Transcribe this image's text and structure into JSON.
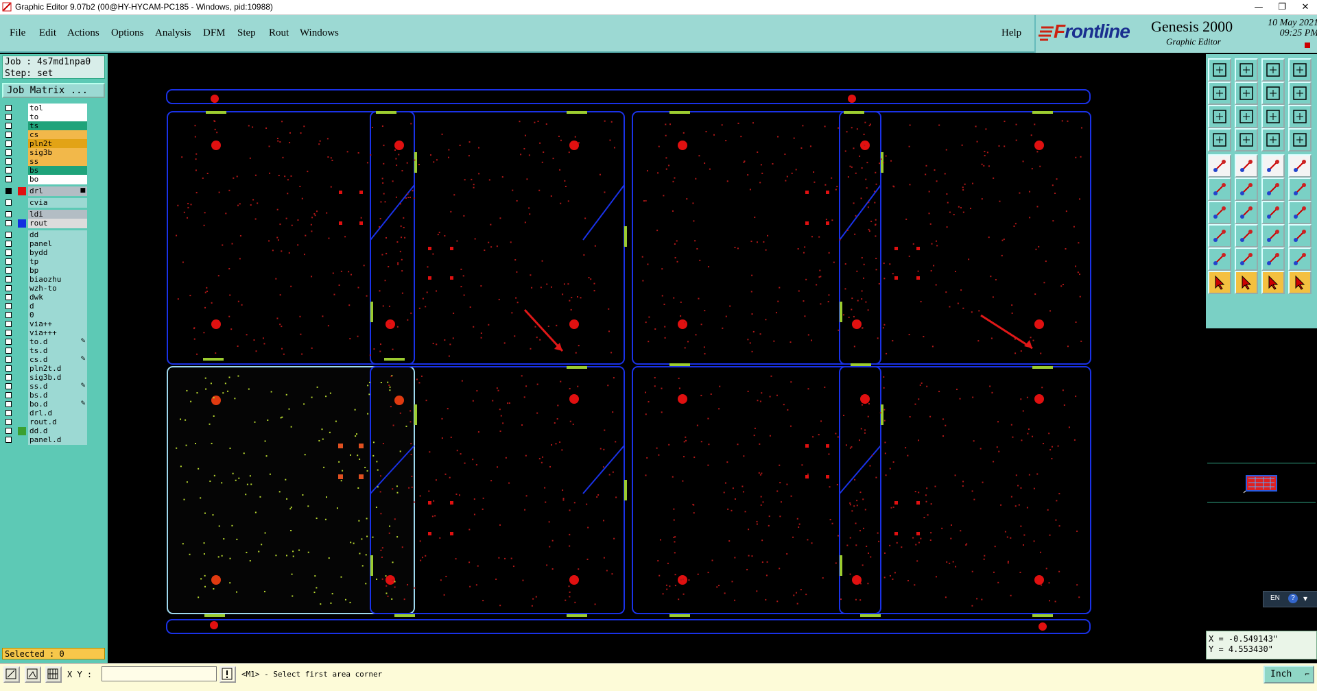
{
  "window": {
    "title": "Graphic Editor 9.07b2 (00@HY-HYCAM-PC185 - Windows, pid:10988)",
    "min": "—",
    "max": "❐",
    "close": "✕"
  },
  "menu": {
    "items": [
      {
        "id": "file",
        "label": "File"
      },
      {
        "id": "edit",
        "label": "Edit"
      },
      {
        "id": "actions",
        "label": "Actions"
      },
      {
        "id": "options",
        "label": "Options"
      },
      {
        "id": "analysis",
        "label": "Analysis"
      },
      {
        "id": "dfm",
        "label": "DFM"
      },
      {
        "id": "step",
        "label": "Step"
      },
      {
        "id": "rout",
        "label": "Rout"
      },
      {
        "id": "windows",
        "label": "Windows"
      }
    ],
    "help": "Help"
  },
  "brand": {
    "logo_first": "F",
    "logo_rest": "rontline",
    "product": "Genesis 2000",
    "subtitle": "Graphic Editor",
    "date": "10 May 2021",
    "time": "09:25 PM"
  },
  "job": {
    "job_line": "Job : 4s7md1npa0",
    "step_line": "Step: set",
    "matrix_button": "Job Matrix ..."
  },
  "layers": [
    {
      "name": "tol",
      "bg": "#ffffff",
      "swatch": ""
    },
    {
      "name": "to",
      "bg": "#ffffff",
      "swatch": ""
    },
    {
      "name": "ts",
      "bg": "#1fa37a",
      "swatch": ""
    },
    {
      "name": "cs",
      "bg": "#f2b84a",
      "swatch": ""
    },
    {
      "name": "pln2t",
      "bg": "#e2a316",
      "swatch": ""
    },
    {
      "name": "sig3b",
      "bg": "#f2b84a",
      "swatch": ""
    },
    {
      "name": "ss",
      "bg": "#f2b84a",
      "swatch": ""
    },
    {
      "name": "bs",
      "bg": "#1fa37a",
      "swatch": ""
    },
    {
      "name": "bo",
      "bg": "#ffffff",
      "swatch": ""
    },
    {
      "name": "drl",
      "bg": "#b3bdc4",
      "swatch": "#e01010",
      "mark": "■"
    },
    {
      "name": "cvia",
      "bg": "#9cd9d3",
      "swatch": ""
    },
    {
      "name": "ldi",
      "bg": "#b3bdc4",
      "swatch": ""
    },
    {
      "name": "rout",
      "bg": "#dcdcdc",
      "swatch": "#1030e0"
    },
    {
      "name": "dd",
      "bg": "#9cd9d3",
      "swatch": ""
    },
    {
      "name": "panel",
      "bg": "#9cd9d3",
      "swatch": ""
    },
    {
      "name": "bydd",
      "bg": "#9cd9d3",
      "swatch": ""
    },
    {
      "name": "tp",
      "bg": "#9cd9d3",
      "swatch": ""
    },
    {
      "name": "bp",
      "bg": "#9cd9d3",
      "swatch": ""
    },
    {
      "name": "biaozhu",
      "bg": "#9cd9d3",
      "swatch": ""
    },
    {
      "name": "wzh-to",
      "bg": "#9cd9d3",
      "swatch": ""
    },
    {
      "name": "dwk",
      "bg": "#9cd9d3",
      "swatch": ""
    },
    {
      "name": "d",
      "bg": "#9cd9d3",
      "swatch": ""
    },
    {
      "name": "0",
      "bg": "#9cd9d3",
      "swatch": ""
    },
    {
      "name": "via++",
      "bg": "#9cd9d3",
      "swatch": ""
    },
    {
      "name": "via+++",
      "bg": "#9cd9d3",
      "swatch": ""
    },
    {
      "name": "to.d",
      "bg": "#9cd9d3",
      "swatch": "",
      "mark": "✎"
    },
    {
      "name": "ts.d",
      "bg": "#9cd9d3",
      "swatch": ""
    },
    {
      "name": "cs.d",
      "bg": "#9cd9d3",
      "swatch": "",
      "mark": "✎"
    },
    {
      "name": "pln2t.d",
      "bg": "#9cd9d3",
      "swatch": ""
    },
    {
      "name": "sig3b.d",
      "bg": "#9cd9d3",
      "swatch": ""
    },
    {
      "name": "ss.d",
      "bg": "#9cd9d3",
      "swatch": "",
      "mark": "✎"
    },
    {
      "name": "bs.d",
      "bg": "#9cd9d3",
      "swatch": ""
    },
    {
      "name": "bo.d",
      "bg": "#9cd9d3",
      "swatch": "",
      "mark": "✎"
    },
    {
      "name": "drl.d",
      "bg": "#9cd9d3",
      "swatch": ""
    },
    {
      "name": "rout.d",
      "bg": "#9cd9d3",
      "swatch": ""
    },
    {
      "name": "dd.d",
      "bg": "#9cd9d3",
      "swatch": "#3aa030"
    },
    {
      "name": "panel.d",
      "bg": "#9cd9d3",
      "swatch": ""
    }
  ],
  "selected": "Selected : 0",
  "tools": [
    "view-top-icon",
    "view-bottom-icon",
    "home-icon",
    "grid-icon",
    "pan-left-icon",
    "pan-right-icon",
    "mirror-icon",
    "split-icon",
    "fit-icon",
    "zoom-fit-icon",
    "scale-icon",
    "query-icon",
    "measure-icon",
    "blank-icon",
    "layer-filter-icon",
    "layer-sort-icon",
    "camera-icon",
    "select-area-icon",
    "ruler-icon",
    "pad-icon",
    "connect-icon",
    "cross-icon",
    "line-add-icon",
    "line-split-icon",
    "draw-line-icon",
    "draw-line2-icon",
    "arc-icon",
    "align-icon",
    "pad-add-icon",
    "line-move-icon",
    "snap-icon",
    "group-icon",
    "triangle-icon",
    "triangle2-icon",
    "polygon-icon",
    "polygon2-icon",
    "pointer-icon",
    "pointer2-icon",
    "pointer3-icon",
    "route-icon"
  ],
  "coords": {
    "x": "X = -0.549143\"",
    "y": "Y =  4.553430\""
  },
  "ime": {
    "lang": "EN",
    "help": "?"
  },
  "status": {
    "xy_label": "X Y :",
    "xy_value": "",
    "prompt": "<M1> - Select first area corner",
    "units": "Inch"
  },
  "colors": {
    "panel": "#9cd9d3",
    "rout": "#1a32e8",
    "drill": "#e01010",
    "tab": "#9ccc30"
  }
}
